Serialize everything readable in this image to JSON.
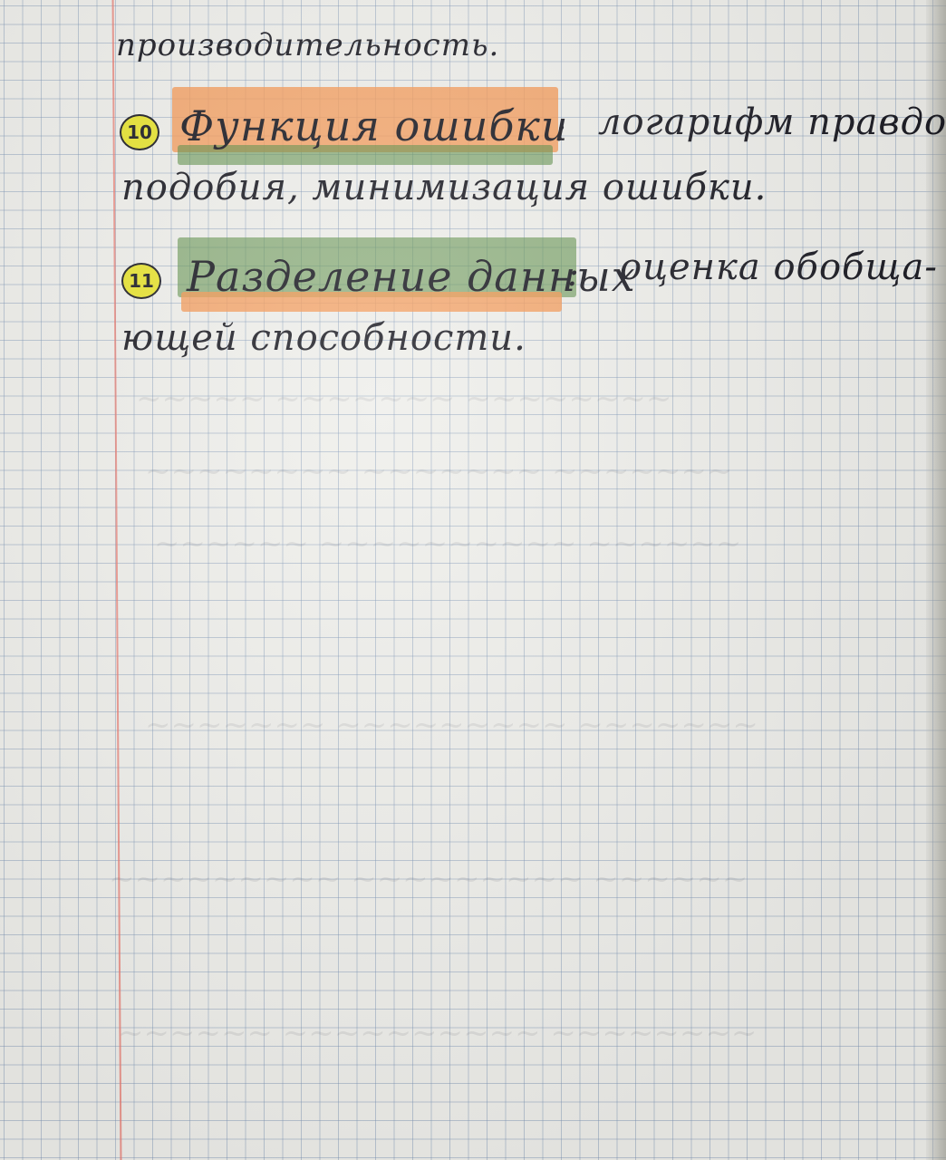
{
  "notes": {
    "line0": "производительность.",
    "item10": {
      "number": "10",
      "term": "Функция ошибки",
      "colon": ":",
      "definition_part1": "логарифм правдо-",
      "definition_part2": "подобия, минимизация ошибки."
    },
    "item11": {
      "number": "11",
      "term": "Разделение данных",
      "colon": ":",
      "definition_part1": "оценка обобща-",
      "definition_part2": "ющей способности."
    }
  },
  "colors": {
    "paper": "#eeeeea",
    "grid": "#7891b4",
    "margin_line": "#e8786e",
    "highlight_orange": "#f59650",
    "highlight_green": "#5a8c46",
    "badge_yellow": "#e7e332",
    "ink": "#1c1c24"
  }
}
